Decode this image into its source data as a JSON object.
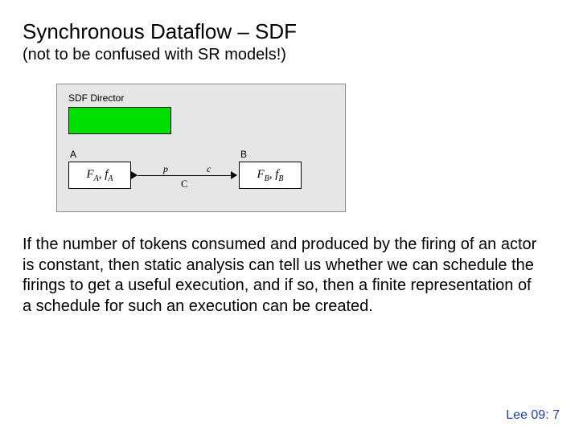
{
  "title": "Synchronous Dataflow – SDF",
  "subtitle": "(not to be confused with SR models!)",
  "diagram": {
    "director_label": "SDF Director",
    "actor_a_label": "A",
    "actor_b_label": "B",
    "actor_a_content_f": "F",
    "actor_a_content_fsub": "A",
    "actor_a_content_comma": ", ",
    "actor_a_content_g": "f",
    "actor_a_content_gsub": "A",
    "actor_b_content_f": "F",
    "actor_b_content_fsub": "B",
    "actor_b_content_comma": ", ",
    "actor_b_content_g": "f",
    "actor_b_content_gsub": "B",
    "edge_p": "p",
    "edge_c": "c",
    "edge_name": "C"
  },
  "body": "If the number of tokens consumed and produced by the firing of an actor is constant, then static analysis can tell us whether we can schedule the firings to get a useful execution, and if so, then a finite representation of a schedule for such an execution can be created.",
  "footer": "Lee 09: 7"
}
